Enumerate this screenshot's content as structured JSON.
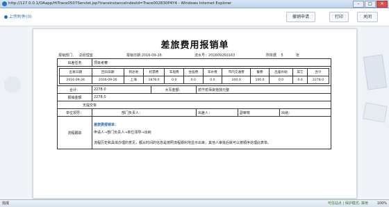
{
  "window": {
    "title": "http://127.0.0.1/OAapp/HiTrace0507Servlet.jsp?traceinstanceIndexId=Trace002830P4Y4 - Windows Internet Explorer",
    "min": "–",
    "max": "□",
    "close": "✕"
  },
  "toolbar": {
    "attachments": "上传附件(0)",
    "revoke": "撤销申请",
    "print": "打印",
    "close": "关闭"
  },
  "doc": {
    "title": "差旅费用报销单",
    "dept_label": "报销部门：",
    "dept_value": "总经理室",
    "date_label": "报销日期:",
    "date_value": "2016-09-26",
    "flow_no_label": "流水号：",
    "flow_no_value": "201609260163",
    "attach_label": "附单据",
    "attach_value": "5",
    "attach_unit": "张",
    "purpose_label": "出差任务",
    "purpose_value": "项目考察",
    "headers": [
      "出发日期",
      "回归日期",
      "到达地",
      "机票费",
      "车船费",
      "住宿费",
      "车补费",
      "市内交通费",
      "餐费",
      "出差补助",
      "其它",
      "合计"
    ],
    "row": [
      "2016-09-26",
      "2016-09-26",
      "上海",
      "1878.0",
      "0.0",
      "0.0",
      "0.0",
      "200.0",
      "100.0",
      "0.0",
      "0.0",
      "2278.0"
    ],
    "subtotal_label": "合计：",
    "subtotal_value": "2278.0",
    "upper_label": "大写金额：",
    "upper_value": "贰仟贰佰柒拾捌元整",
    "reimburse_label": "报销金额",
    "reimburse_value": "2278.0",
    "uninvoiced_label": "无提交单",
    "leader_label": "单位领导：",
    "dept_head_label": "部门负责人：",
    "traveler_label": "出差人：",
    "reviewer_label": "副审核",
    "cashier_label": "出纳：",
    "process_label": "流程跟踪",
    "process_title": "差旅费报销单：",
    "process_step": "申请人→部门负责人→单位领导→出纳",
    "process_note": "流程历史和具体办理的意见，都从时间的信息是按照流程顺利地显示出来，其他人审批后就可以按顺序处理此表单。"
  },
  "status": {
    "left": "完成",
    "zone": "可信站点 | 保护模式: 禁用",
    "zoom": "100%"
  }
}
